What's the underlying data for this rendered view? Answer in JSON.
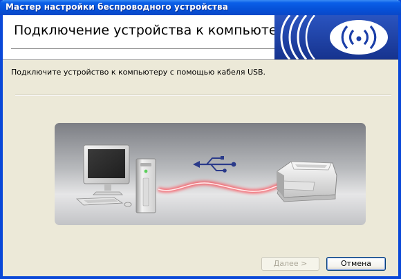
{
  "window": {
    "title": "Мастер настройки беспроводного устройства"
  },
  "header": {
    "title": "Подключение устройства к компьютеру",
    "logo_icon": "wireless-signal-icon"
  },
  "main": {
    "instruction": "Подключите устройство к компьютеру с помощью кабеля USB.",
    "illustration": {
      "icons": [
        "computer-icon",
        "usb-icon",
        "usb-cable",
        "printer-icon"
      ]
    }
  },
  "buttons": {
    "next_label": "Далее >",
    "cancel_label": "Отмена",
    "next_enabled": false
  },
  "colors": {
    "titlebar": "#0a5fe8",
    "dialog_background": "#ece9d8",
    "header_background": "#ffffff",
    "logo_blue": "#1a3ea8",
    "cable_glow": "#e8303a"
  }
}
